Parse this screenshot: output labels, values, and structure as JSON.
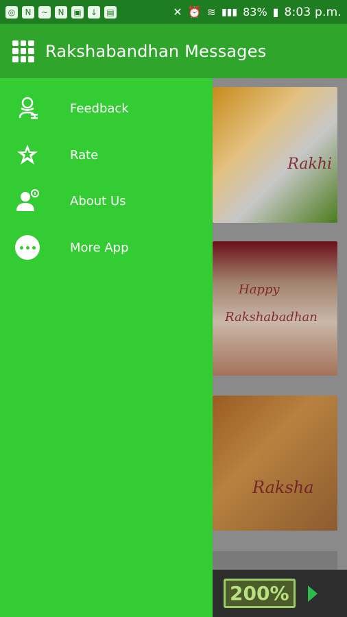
{
  "status_bar": {
    "battery_percent": "83%",
    "time": "8:03 p.m."
  },
  "app_bar": {
    "title": "Rakshabandhan Messages",
    "menu_icon": "grid-icon"
  },
  "drawer": {
    "items": [
      {
        "label": "Feedback",
        "icon": "support-agent-icon"
      },
      {
        "label": "Rate",
        "icon": "star-icon"
      },
      {
        "label": "About Us",
        "icon": "person-info-icon"
      },
      {
        "label": "More App",
        "icon": "more-dots-icon"
      }
    ]
  },
  "cards": [
    {
      "text": "Rakhi"
    },
    {
      "text_top": "Happy",
      "text_main": "Rakshabadhan"
    },
    {
      "text_main": "Raksha"
    }
  ],
  "ad": {
    "text": "200%"
  },
  "colors": {
    "status_bar": "#1f7d21",
    "app_bar": "#2fa52b",
    "drawer": "#33cc33",
    "text": "#ffffff"
  }
}
